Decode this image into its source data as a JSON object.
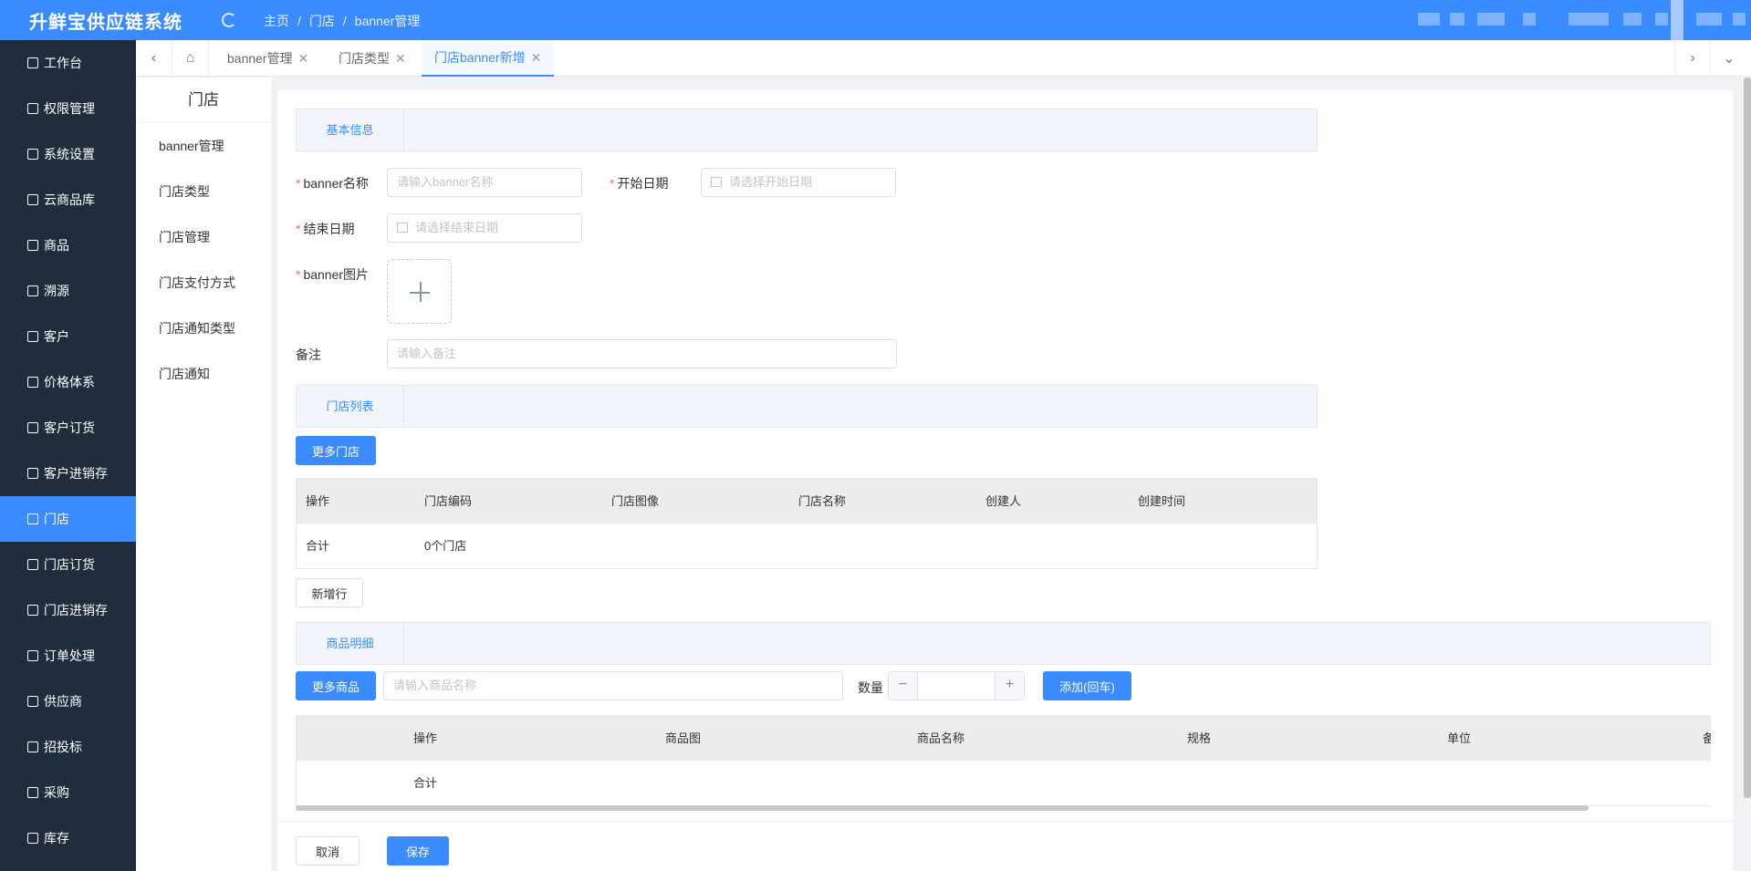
{
  "app": {
    "title": "升鲜宝供应链系统"
  },
  "breadcrumb": [
    "主页",
    "/",
    "门店",
    "/",
    "banner管理"
  ],
  "sidebar": {
    "items": [
      {
        "label": "工作台",
        "icon": "monitor-icon"
      },
      {
        "label": "权限管理",
        "icon": "shield-icon"
      },
      {
        "label": "系统设置",
        "icon": "gear-icon"
      },
      {
        "label": "云商品库",
        "icon": "cloud-icon"
      },
      {
        "label": "商品",
        "icon": "goods-icon"
      },
      {
        "label": "溯源",
        "icon": "trace-icon"
      },
      {
        "label": "客户",
        "icon": "customer-icon"
      },
      {
        "label": "价格体系",
        "icon": "price-icon"
      },
      {
        "label": "客户订货",
        "icon": "order-icon"
      },
      {
        "label": "客户进销存",
        "icon": "bank-icon"
      },
      {
        "label": "门店",
        "icon": "store-icon"
      },
      {
        "label": "门店订货",
        "icon": "store-order-icon"
      },
      {
        "label": "门店进销存",
        "icon": "store-stock-icon"
      },
      {
        "label": "订单处理",
        "icon": "send-icon"
      },
      {
        "label": "供应商",
        "icon": "supplier-icon"
      },
      {
        "label": "招投标",
        "icon": "user-icon"
      },
      {
        "label": "采购",
        "icon": "purchase-icon"
      },
      {
        "label": "库存",
        "icon": "inventory-icon"
      }
    ],
    "active_index": 10
  },
  "tabs": [
    {
      "label": "banner管理"
    },
    {
      "label": "门店类型"
    },
    {
      "label": "门店banner新增"
    }
  ],
  "submenu": {
    "title": "门店",
    "items": [
      "banner管理",
      "门店类型",
      "门店管理",
      "门店支付方式",
      "门店通知类型",
      "门店通知"
    ]
  },
  "form": {
    "basic_section": "基本信息",
    "banner_name_label": "banner名称",
    "banner_name_placeholder": "请输入banner名称",
    "start_date_label": "开始日期",
    "start_date_placeholder": "请选择开始日期",
    "end_date_label": "结束日期",
    "end_date_placeholder": "请选择结束日期",
    "image_label": "banner图片",
    "remark_label": "备注",
    "remark_placeholder": "请输入备注",
    "required_mark": "*"
  },
  "store_list": {
    "section": "门店列表",
    "more_button": "更多门店",
    "columns": [
      "操作",
      "门店编码",
      "门店图像",
      "门店名称",
      "创建人",
      "创建时间"
    ],
    "total_label": "合计",
    "total_value": "0个门店",
    "add_row_button": "新增行"
  },
  "goods": {
    "section": "商品明细",
    "more_button": "更多商品",
    "search_placeholder": "请输入商品名称",
    "qty_label": "数量",
    "minus": "−",
    "plus": "+",
    "add_button": "添加(回车)",
    "columns": [
      "操作",
      "商品图",
      "商品名称",
      "规格",
      "单位",
      "备"
    ],
    "total_label": "合计"
  },
  "footer": {
    "cancel": "取消",
    "save": "保存"
  },
  "colors": {
    "primary": "#3a8bff",
    "sidebar": "#1f2d3d",
    "required": "#f56c6c"
  }
}
